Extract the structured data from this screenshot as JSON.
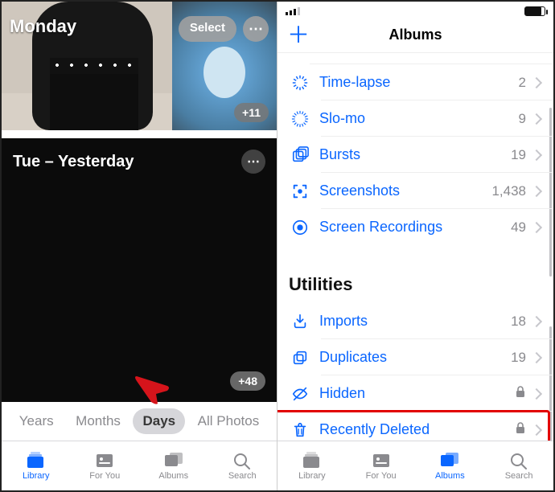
{
  "left": {
    "day1_label": "Monday",
    "select_label": "Select",
    "more_glyph": "⋯",
    "day1_count_badge": "+11",
    "day2_label": "Tue – Yesterday",
    "day2_count_badge": "+48",
    "segments": {
      "years": "Years",
      "months": "Months",
      "days": "Days",
      "all": "All Photos",
      "active": "days"
    },
    "tabs": {
      "library": "Library",
      "for_you": "For You",
      "albums": "Albums",
      "search": "Search",
      "active": "library"
    }
  },
  "right": {
    "navbar": {
      "title": "Albums",
      "plus_glyph": "＋"
    },
    "media_types": [
      {
        "icon": "timelapse",
        "label": "Time-lapse",
        "count": "2"
      },
      {
        "icon": "slomo",
        "label": "Slo-mo",
        "count": "9"
      },
      {
        "icon": "bursts",
        "label": "Bursts",
        "count": "19"
      },
      {
        "icon": "screenshots",
        "label": "Screenshots",
        "count": "1,438"
      },
      {
        "icon": "screenrec",
        "label": "Screen Recordings",
        "count": "49"
      }
    ],
    "utilities_header": "Utilities",
    "utilities": [
      {
        "icon": "imports",
        "label": "Imports",
        "count": "18"
      },
      {
        "icon": "duplicates",
        "label": "Duplicates",
        "count": "19"
      },
      {
        "icon": "hidden",
        "label": "Hidden",
        "locked": true
      },
      {
        "icon": "trash",
        "label": "Recently Deleted",
        "locked": true,
        "highlight": true
      }
    ],
    "tabs": {
      "library": "Library",
      "for_you": "For You",
      "albums": "Albums",
      "search": "Search",
      "active": "albums"
    }
  }
}
